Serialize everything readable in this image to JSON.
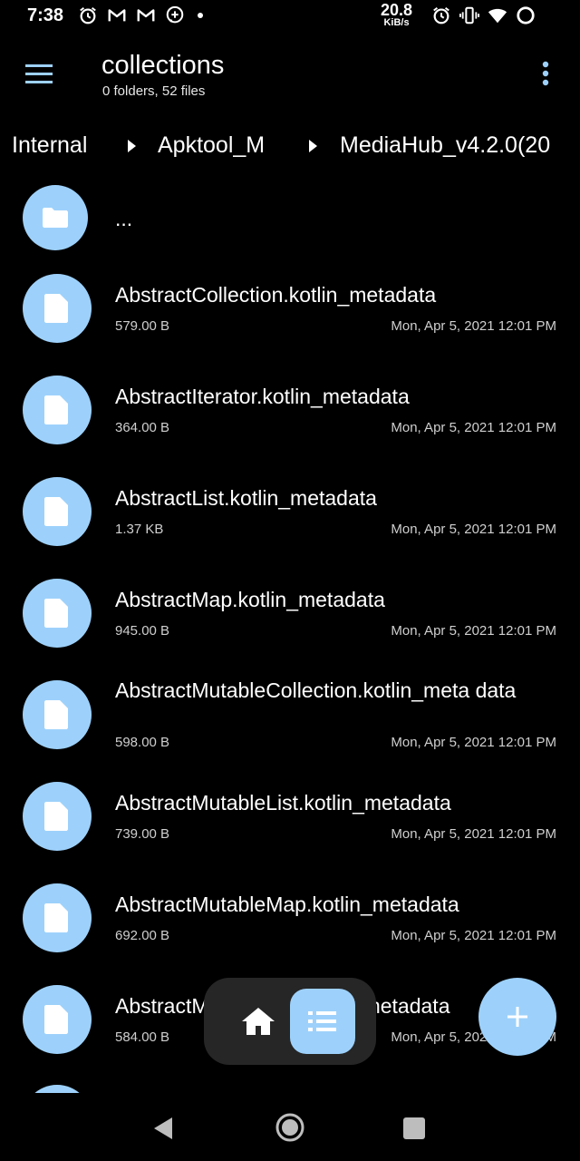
{
  "status_bar": {
    "time": "7:38",
    "net_speed": "20.8",
    "net_unit": "KiB/s"
  },
  "header": {
    "title": "collections",
    "subtitle": "0 folders, 52 files"
  },
  "breadcrumb": [
    "Internal",
    "Apktool_M",
    "MediaHub_v4.2.0(20"
  ],
  "parent_folder_label": "...",
  "files": [
    {
      "name": "AbstractCollection.kotlin_metadata",
      "size": "579.00 B",
      "date": "Mon, Apr 5, 2021 12:01 PM"
    },
    {
      "name": "AbstractIterator.kotlin_metadata",
      "size": "364.00 B",
      "date": "Mon, Apr 5, 2021 12:01 PM"
    },
    {
      "name": "AbstractList.kotlin_metadata",
      "size": "1.37 KB",
      "date": "Mon, Apr 5, 2021 12:01 PM"
    },
    {
      "name": "AbstractMap.kotlin_metadata",
      "size": "945.00 B",
      "date": "Mon, Apr 5, 2021 12:01 PM"
    },
    {
      "name": "AbstractMutableCollection.kotlin_meta data",
      "size": "598.00 B",
      "date": "Mon, Apr 5, 2021 12:01 PM"
    },
    {
      "name": "AbstractMutableList.kotlin_metadata",
      "size": "739.00 B",
      "date": "Mon, Apr 5, 2021 12:01 PM"
    },
    {
      "name": "AbstractMutableMap.kotlin_metadata",
      "size": "692.00 B",
      "date": "Mon, Apr 5, 2021 12:01 PM"
    },
    {
      "name": "AbstractMutableSet.kotlin_metadata",
      "size": "584.00 B",
      "date": "Mon, Apr 5, 2021 12:01 PM"
    }
  ],
  "colors": {
    "accent": "#9dd1fb",
    "background": "#000000",
    "pill": "#262626"
  },
  "icons": {
    "menu": "hamburger-icon",
    "more": "more-vert-icon",
    "folder": "folder-icon",
    "file": "file-icon",
    "home": "home-icon",
    "list": "list-icon",
    "add": "plus-icon"
  }
}
